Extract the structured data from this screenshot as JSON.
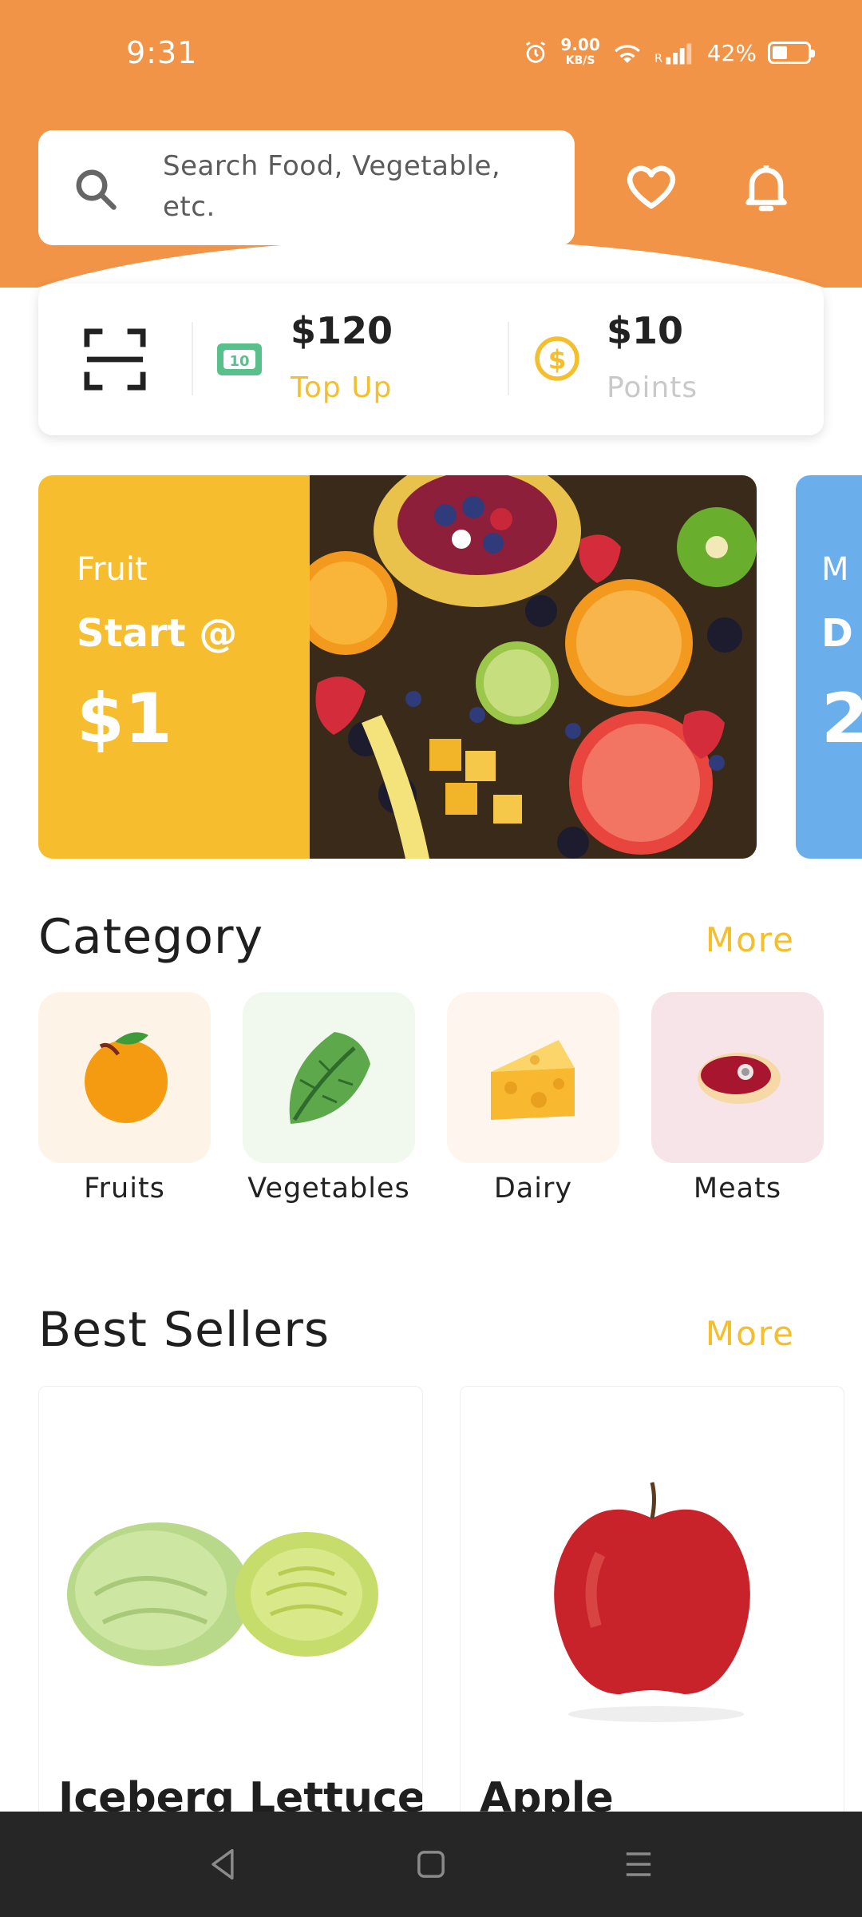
{
  "status_bar": {
    "time": "9:31",
    "speed_value": "9.00",
    "speed_unit": "KB/S",
    "battery": "42%"
  },
  "search": {
    "placeholder": "Search Food, Vegetable, etc."
  },
  "wallet": {
    "balance_amount": "$120",
    "balance_action": "Top Up",
    "points_amount": "$10",
    "points_label": "Points"
  },
  "banner": {
    "category": "Fruit",
    "start_text": "Start @",
    "price": "$1",
    "next_category_partial": "M",
    "next_line2_partial": "D",
    "next_price_partial": "2"
  },
  "category_section": {
    "title": "Category",
    "more_label": "More",
    "items": [
      {
        "label": "Fruits"
      },
      {
        "label": "Vegetables"
      },
      {
        "label": "Dairy"
      },
      {
        "label": "Meats"
      }
    ]
  },
  "best_sellers": {
    "title": "Best Sellers",
    "more_label": "More",
    "products": [
      {
        "name": "Iceberg Lettuce"
      },
      {
        "name": "Apple"
      }
    ]
  },
  "colors": {
    "header": "#F29447",
    "accent_yellow": "#F4BE2C",
    "banner_yellow": "#F6BE2E",
    "banner_blue": "#6AAEEB"
  }
}
